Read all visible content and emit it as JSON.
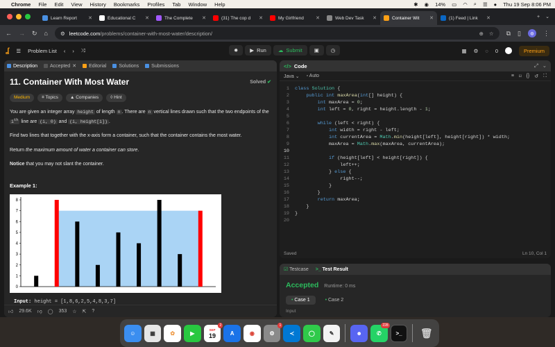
{
  "menubar": {
    "app": "Chrome",
    "items": [
      "File",
      "Edit",
      "View",
      "History",
      "Bookmarks",
      "Profiles",
      "Tab",
      "Window",
      "Help"
    ],
    "battery": "14%",
    "datetime": "Thu 19 Sep  8:06 PM"
  },
  "tabs": [
    {
      "label": "Learn Report",
      "color": "#4a90e2"
    },
    {
      "label": "Educational C",
      "color": "#ffffff"
    },
    {
      "label": "The Complete",
      "color": "#a259ff"
    },
    {
      "label": "(31) The cop d",
      "color": "#ff0000"
    },
    {
      "label": "My Girlfriend",
      "color": "#ff0000"
    },
    {
      "label": "Web Dev Task",
      "color": "#888888"
    },
    {
      "label": "Container Wit",
      "color": "#ffa116"
    },
    {
      "label": "(1) Feed | Link",
      "color": "#0a66c2"
    }
  ],
  "address": {
    "host": "leetcode.com",
    "path": "/problems/container-with-most-water/description/"
  },
  "lcnav": {
    "problem_list": "Problem List",
    "run": "Run",
    "submit": "Submit",
    "streak": "0",
    "premium": "Premium"
  },
  "problem": {
    "tabs": [
      "Description",
      "Accepted",
      "Editorial",
      "Solutions",
      "Submissions"
    ],
    "title": "11. Container With Most Water",
    "solved": "Solved",
    "chips": [
      "Medium",
      "Topics",
      "Companies",
      "Hint"
    ],
    "p1_a": "You are given an integer array ",
    "p1_code1": "height",
    "p1_b": " of length ",
    "p1_code2": "n",
    "p1_c": ". There are ",
    "p1_code3": "n",
    "p1_d": " vertical lines drawn such that the two endpoints of the ",
    "p1_sup": "i",
    "p1_supth": "th",
    "p1_e": " line are ",
    "p1_code4": "(i, 0)",
    "p1_f": " and ",
    "p1_code5": "(i, height[i])",
    "p1_g": ".",
    "p2": "Find two lines that together with the x-axis form a container, such that the container contains the most water.",
    "p3_a": "Return ",
    "p3_em": "the maximum amount of water a container can store",
    "p3_b": ".",
    "p4_bold": "Notice",
    "p4_rest": " that you may not slant the container.",
    "example": "Example 1:",
    "input_label": "Input:",
    "input_value": "height = [1,8,6,2,5,4,8,3,7]",
    "likes": "29.6K",
    "comments": "353"
  },
  "chart_data": {
    "type": "bar",
    "values": [
      1,
      8,
      6,
      2,
      5,
      4,
      8,
      3,
      7
    ],
    "highlight_indices": [
      1,
      8
    ],
    "water_level": 7,
    "ylim": [
      0,
      8
    ],
    "yticks": [
      "0",
      "1",
      "2",
      "3",
      "4",
      "5",
      "6",
      "7",
      "8"
    ],
    "bar_color": "#000000",
    "highlight_color": "#ff0000",
    "water_color": "#aad4f5"
  },
  "editor": {
    "title": "Code",
    "language": "Java",
    "mode": "Auto",
    "status": "Saved",
    "position": "Ln 10, Col 1",
    "lines": [
      "class Solution {",
      "    public int maxArea(int[] height) {",
      "        int maxArea = 0;",
      "        int left = 0, right = height.length - 1;",
      "",
      "        while (left < right) {",
      "            int width = right - left;",
      "            int currentArea = Math.min(height[left], height[right]) * width;",
      "            maxArea = Math.max(maxArea, currentArea);",
      "",
      "            if (height[left] < height[right]) {",
      "                left++;",
      "            } else {",
      "                right--;",
      "            }",
      "        }",
      "        return maxArea;",
      "    }",
      "}",
      ""
    ]
  },
  "test": {
    "tab1": "Testcase",
    "tab2": "Test Result",
    "result": "Accepted",
    "runtime": "Runtime: 0 ms",
    "case1": "Case 1",
    "case2": "Case 2",
    "input_label": "Input"
  },
  "dock": {
    "calendar_month": "SEP",
    "calendar_day": "19",
    "calendar_badge": "2",
    "settings_badge": "1",
    "whatsapp_badge": "228"
  }
}
